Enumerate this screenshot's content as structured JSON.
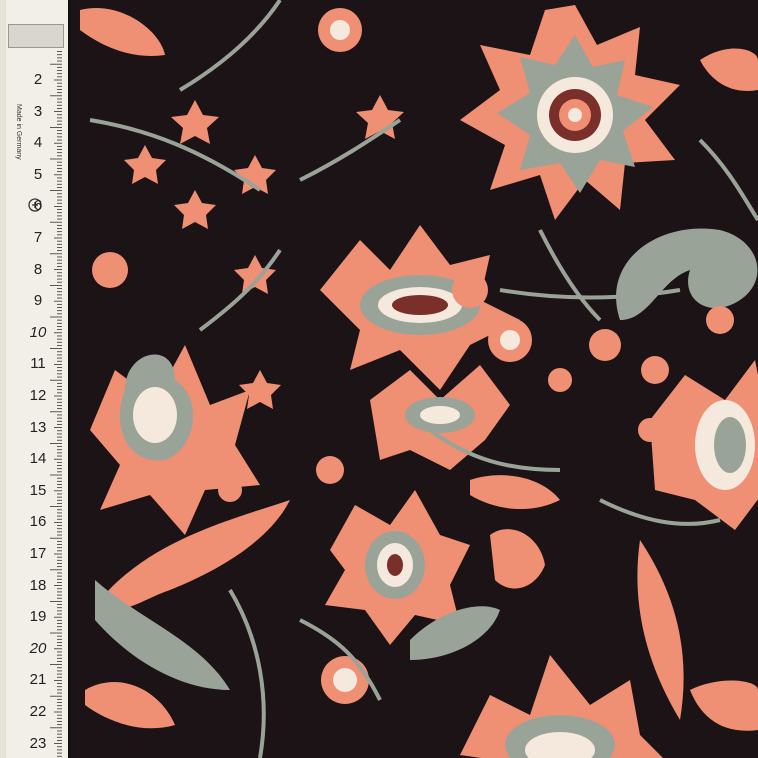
{
  "scene": {
    "fabric_colors": {
      "background": "#1c1316",
      "coral": "#ef8f73",
      "sage": "#9aa398",
      "maroon": "#7a2f2a",
      "cream": "#f4e9dc"
    },
    "tape": {
      "numbers": [
        "2",
        "3",
        "4",
        "5",
        "6",
        "7",
        "8",
        "9",
        "10",
        "11",
        "12",
        "13",
        "14",
        "15",
        "16",
        "17",
        "18",
        "19",
        "20",
        "21",
        "22",
        "23"
      ],
      "brand_text": "Made in Germany"
    }
  }
}
